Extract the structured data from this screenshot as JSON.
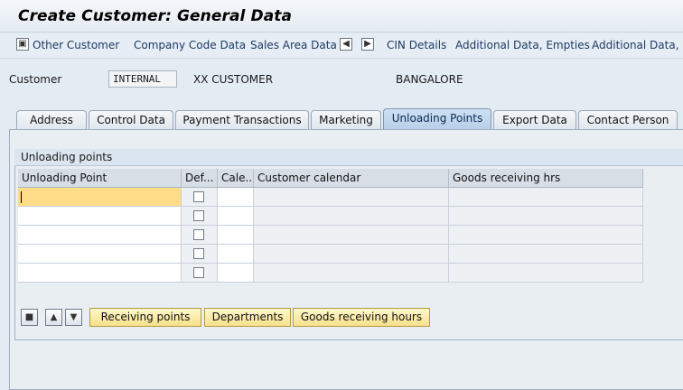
{
  "window": {
    "title": "Create Customer: General Data"
  },
  "toolbar": {
    "items": [
      {
        "label": "Other Customer",
        "icon": "other-customer-icon"
      },
      {
        "label": "Company Code Data"
      },
      {
        "label": "Sales Area Data"
      },
      {
        "icon": "previous-screen-icon"
      },
      {
        "icon": "next-screen-icon"
      },
      {
        "label": "CIN Details"
      },
      {
        "label": "Additional Data, Empties"
      },
      {
        "label": "Additional Data, DS"
      }
    ]
  },
  "header": {
    "customer_label": "Customer",
    "customer_number": "INTERNAL",
    "customer_name": "XX CUSTOMER",
    "city": "BANGALORE"
  },
  "tabs": [
    {
      "label": "Address"
    },
    {
      "label": "Control Data"
    },
    {
      "label": "Payment Transactions"
    },
    {
      "label": "Marketing"
    },
    {
      "label": "Unloading Points",
      "active": true
    },
    {
      "label": "Export Data"
    },
    {
      "label": "Contact Person"
    }
  ],
  "unloading": {
    "group_title": "Unloading points",
    "columns": [
      "Unloading Point",
      "Def...",
      "Cale...",
      "Customer calendar",
      "Goods receiving hrs"
    ],
    "rows": [
      {
        "point": "",
        "default": false,
        "calendar": "",
        "customer_calendar": "",
        "goods_hrs": ""
      },
      {
        "point": "",
        "default": false,
        "calendar": "",
        "customer_calendar": "",
        "goods_hrs": ""
      },
      {
        "point": "",
        "default": false,
        "calendar": "",
        "customer_calendar": "",
        "goods_hrs": ""
      },
      {
        "point": "",
        "default": false,
        "calendar": "",
        "customer_calendar": "",
        "goods_hrs": ""
      },
      {
        "point": "",
        "default": false,
        "calendar": "",
        "customer_calendar": "",
        "goods_hrs": ""
      }
    ]
  },
  "actions": {
    "icons": [
      "delete-row-icon",
      "insert-row-icon",
      "filter-icon"
    ],
    "receiving_points": "Receiving points",
    "departments": "Departments",
    "goods_receiving_hours": "Goods receiving hours"
  },
  "colors": {
    "active_tab": "#b7cfe8",
    "selected_cell": "#ffdd88",
    "action_button": "#f6e08a"
  }
}
